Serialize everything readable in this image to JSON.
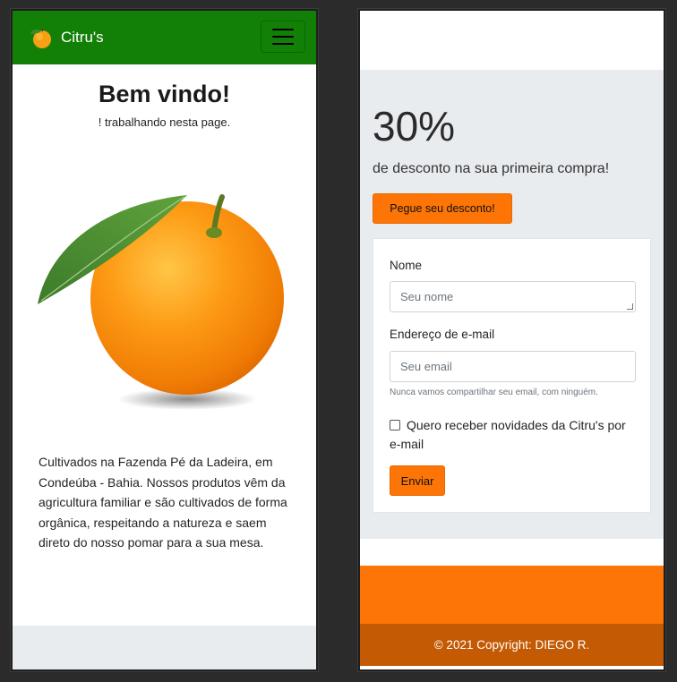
{
  "navbar": {
    "brand": "Citru's",
    "toggle_icon": "hamburger-icon",
    "bg_color": "#128006"
  },
  "hero": {
    "title": "Bem vindo!",
    "subtitle": "! trabalhando nesta page.",
    "description": "Cultivados na Fazenda Pé da Ladeira, em Condeúba - Bahia. Nossos produtos vêm da agricultura familiar e são cultivados de forma orgânica, respeitando a natureza e saem direto do nosso pomar para a sua mesa."
  },
  "promo": {
    "headline": "30%",
    "lead": "de desconto na sua primeira compra!",
    "cta_label": "Pegue seu desconto!",
    "accent_color": "#fd7506"
  },
  "form": {
    "name_label": "Nome",
    "name_placeholder": "Seu nome",
    "email_label": "Endereço de e-mail",
    "email_placeholder": "Seu email",
    "email_help": "Nunca vamos compartilhar seu email, com ninguém.",
    "newsletter_label_line1": "Quero receber novidades da Citru's por",
    "newsletter_label_line2": "e-mail",
    "newsletter_checked": false,
    "submit_label": "Enviar"
  },
  "footer": {
    "copyright": "© 2021 Copyright: DIEGO R.",
    "bg_color": "#c45a04"
  }
}
